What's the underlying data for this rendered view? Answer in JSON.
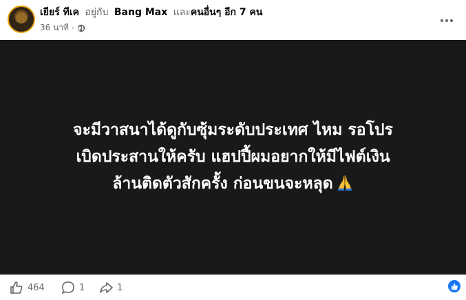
{
  "post": {
    "author": "เยียร์ ทีเค",
    "with_text": "อยู่กับ",
    "tagged_name": "Bang Max",
    "and_text": "และ",
    "others_text": "คนอื่นๆ อีก 7 คน",
    "timestamp": "36 นาที",
    "privacy_icon": "globe-icon",
    "body_lines": [
      "จะมีวาสนาได้ดูกับซุ้มระดับประเทศ ไหม รอโปร",
      "เบิดประสานให้ครับ แฮปปี้ผมอยากให้มีไฟต์เงิน",
      "ล้านติดตัวสักครั้ง ก่อนขนจะหลุด"
    ],
    "body_emoji_icon": "folded-hands-icon",
    "background_color": "#18191a"
  },
  "footer": {
    "like_count": "464",
    "comment_count": "1",
    "share_count": "1",
    "reaction_icon": "like-badge-icon"
  },
  "colors": {
    "accent": "#1877f2",
    "muted": "#65676b",
    "avatar_ring": "#e4a10b"
  }
}
